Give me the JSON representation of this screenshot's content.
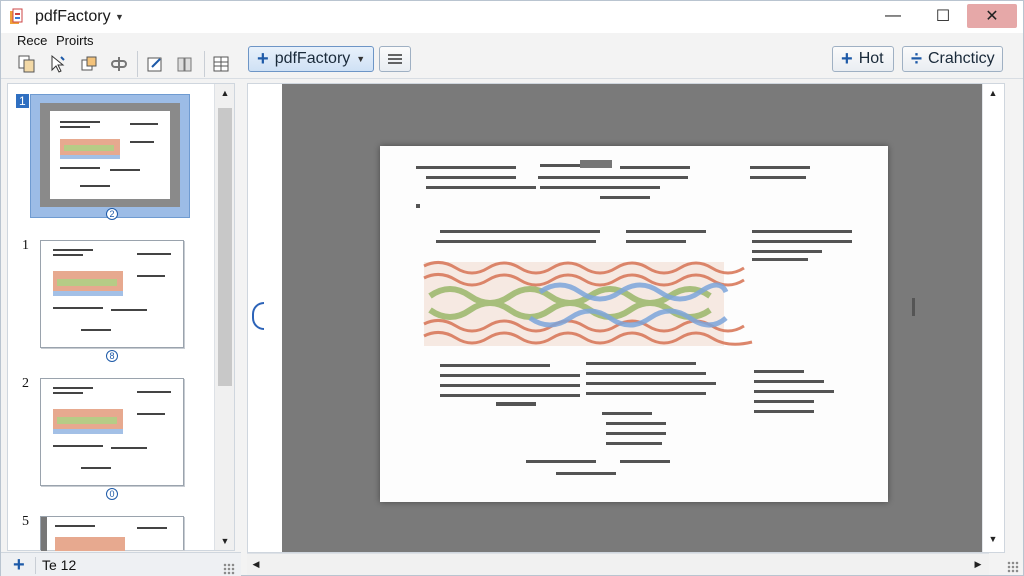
{
  "app": {
    "title": "pdfFactory"
  },
  "window_controls": {
    "minimize": "—",
    "maximize": "☐",
    "close": "✕"
  },
  "menu": {
    "items": [
      "Rece",
      "Proirts"
    ]
  },
  "toolbar": {
    "icons": [
      "pages-icon",
      "select-cursor-icon",
      "crop-icon",
      "link-icon",
      "edit-icon",
      "book-icon",
      "grid-icon"
    ],
    "main_button": "pdfFactory",
    "hot_button": "Hot",
    "crah_button": "Crahcticy"
  },
  "thumbnails": [
    {
      "number": "1",
      "badge": "2",
      "selected": true
    },
    {
      "number": "1",
      "badge": "8",
      "selected": false
    },
    {
      "number": "2",
      "badge": "0",
      "selected": false
    },
    {
      "number": "5",
      "badge": "",
      "selected": false
    }
  ],
  "status": {
    "text": "Te 12"
  },
  "colors": {
    "accent": "#1e5aa8",
    "selection": "#9cbce6",
    "canvas": "#7a7a7a",
    "close_hover": "#e6a8a8"
  }
}
